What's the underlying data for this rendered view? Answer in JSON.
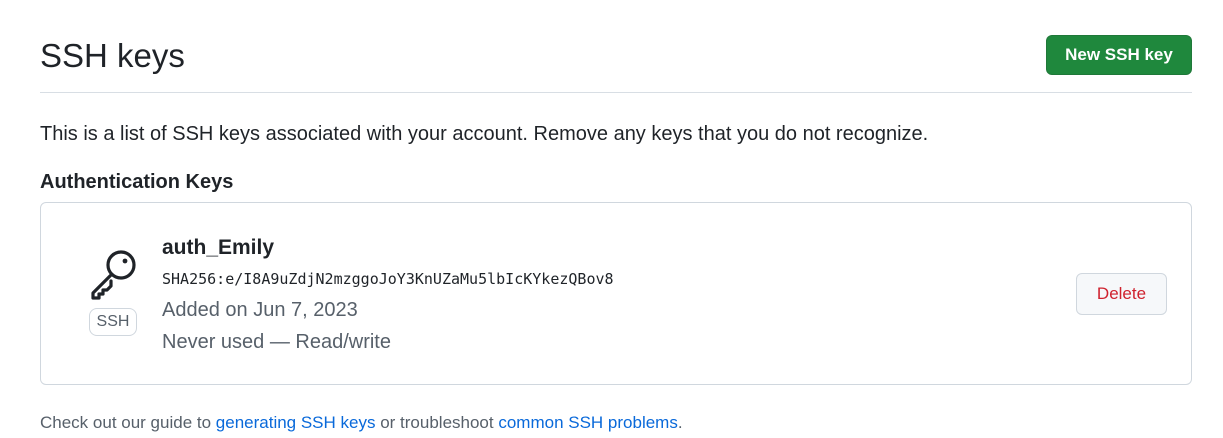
{
  "header": {
    "title": "SSH keys",
    "new_key_button": "New SSH key"
  },
  "intro": "This is a list of SSH keys associated with your account. Remove any keys that you do not recognize.",
  "section_title": "Authentication Keys",
  "keys": [
    {
      "type_badge": "SSH",
      "title": "auth_Emily",
      "fingerprint": "SHA256:e/I8A9uZdjN2mzggoJoY3KnUZaMu5lbIcKYkezQBov8",
      "added": "Added on Jun 7, 2023",
      "usage": "Never used — Read/write",
      "delete_label": "Delete",
      "icon": "key-icon"
    }
  ],
  "footer": {
    "prefix": "Check out our guide to ",
    "link1": "generating SSH keys",
    "middle": " or troubleshoot ",
    "link2": "common SSH problems",
    "suffix": "."
  },
  "colors": {
    "primary_button": "#1f883d",
    "danger_text": "#cf222e",
    "link": "#0969da",
    "muted_text": "#57606a"
  }
}
